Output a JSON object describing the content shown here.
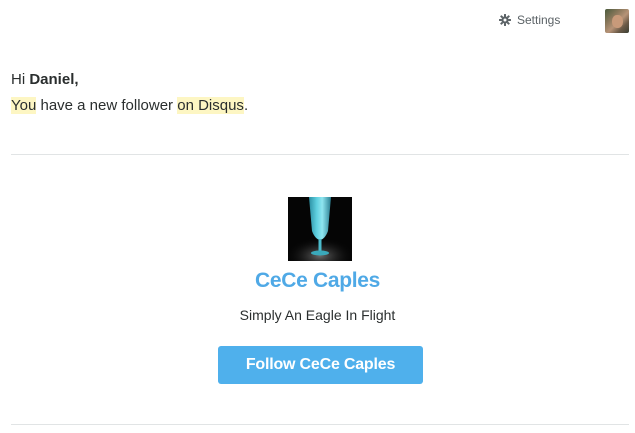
{
  "header": {
    "settings_label": "Settings",
    "settings_icon": "gear-icon",
    "avatar_icon": "user-avatar"
  },
  "email": {
    "greeting_prefix": "Hi",
    "recipient_name": "Daniel,",
    "message_part1": "You",
    "message_part2": " have a new follower ",
    "message_part3": "on Disqus",
    "message_part4": ".",
    "highlight_color": "#fdf6c3"
  },
  "follower": {
    "name": "CeCe Caples",
    "bio": "Simply An Eagle In Flight",
    "follow_button_label": "Follow CeCe Caples",
    "name_color": "#4fa9e6",
    "button_color": "#4fb0ec"
  }
}
